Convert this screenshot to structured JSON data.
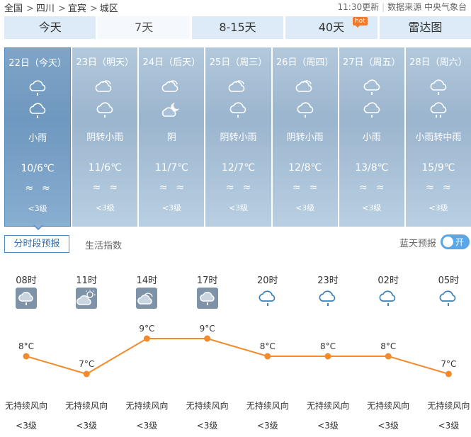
{
  "breadcrumb": [
    "全国",
    "四川",
    "宜宾",
    "城区"
  ],
  "update_time": "11:30更新",
  "source_label": "数据来源",
  "source": "中央气象台",
  "tabs": [
    {
      "label": "今天"
    },
    {
      "label": "7天"
    },
    {
      "label": "8-15天"
    },
    {
      "label": "40天",
      "badge": "hot"
    },
    {
      "label": "雷达图"
    }
  ],
  "days": [
    {
      "date": "22日（今天）",
      "weather": "小雨",
      "temp": "10/6℃",
      "wind": "≈≈",
      "level": "<3级",
      "icon1": "rain",
      "icon2": "rain"
    },
    {
      "date": "23日（明天）",
      "weather": "阴转小雨",
      "temp": "11/6℃",
      "wind": "≈≈",
      "level": "<3级",
      "icon1": "cloud",
      "icon2": "rain"
    },
    {
      "date": "24日（后天）",
      "weather": "阴",
      "temp": "11/7℃",
      "wind": "≈≈",
      "level": "<3级",
      "icon1": "cloud",
      "icon2": "moon-cloud"
    },
    {
      "date": "25日（周三）",
      "weather": "阴转小雨",
      "temp": "12/7℃",
      "wind": "≈≈",
      "level": "<3级",
      "icon1": "cloud",
      "icon2": "rain"
    },
    {
      "date": "26日（周四）",
      "weather": "阴转小雨",
      "temp": "12/8℃",
      "wind": "≈≈",
      "level": "<3级",
      "icon1": "cloud",
      "icon2": "rain"
    },
    {
      "date": "27日（周五）",
      "weather": "小雨",
      "temp": "13/8℃",
      "wind": "≈≈",
      "level": "<3级",
      "icon1": "rain",
      "icon2": "rain"
    },
    {
      "date": "28日（周六）",
      "weather": "小雨转中雨",
      "temp": "15/9℃",
      "wind": "≈≈",
      "level": "<3级",
      "icon1": "rain",
      "icon2": "heavy-rain"
    }
  ],
  "subtabs": {
    "hourly": "分时段预报",
    "life": "生活指数"
  },
  "bluesky": {
    "label": "蓝天预报",
    "toggle": "开"
  },
  "colors": {
    "accent": "#4d8bc4",
    "trend": "#f28a2e",
    "tab_bg": "#dcebf7",
    "hot": "#f07a2c"
  },
  "hourly": [
    {
      "time": "08时",
      "temp": 8,
      "temp_label": "8°C",
      "wind": "无持续风向",
      "level": "<3级",
      "icon": "rain-box"
    },
    {
      "time": "11时",
      "temp": 7,
      "temp_label": "7°C",
      "wind": "无持续风向",
      "level": "<3级",
      "icon": "sun-cloud-box"
    },
    {
      "time": "14时",
      "temp": 9,
      "temp_label": "9°C",
      "wind": "无持续风向",
      "level": "<3级",
      "icon": "cloud-box"
    },
    {
      "time": "17时",
      "temp": 9,
      "temp_label": "9°C",
      "wind": "无持续风向",
      "level": "<3级",
      "icon": "rain-box"
    },
    {
      "time": "20时",
      "temp": 8,
      "temp_label": "8°C",
      "wind": "无持续风向",
      "level": "<3级",
      "icon": "rain-night"
    },
    {
      "time": "23时",
      "temp": 8,
      "temp_label": "8°C",
      "wind": "无持续风向",
      "level": "<3级",
      "icon": "rain-night"
    },
    {
      "time": "02时",
      "temp": 8,
      "temp_label": "8°C",
      "wind": "无持续风向",
      "level": "<3级",
      "icon": "rain-night"
    },
    {
      "time": "05时",
      "temp": 7,
      "temp_label": "7°C",
      "wind": "无持续风向",
      "level": "<3级",
      "icon": "rain-night"
    }
  ]
}
